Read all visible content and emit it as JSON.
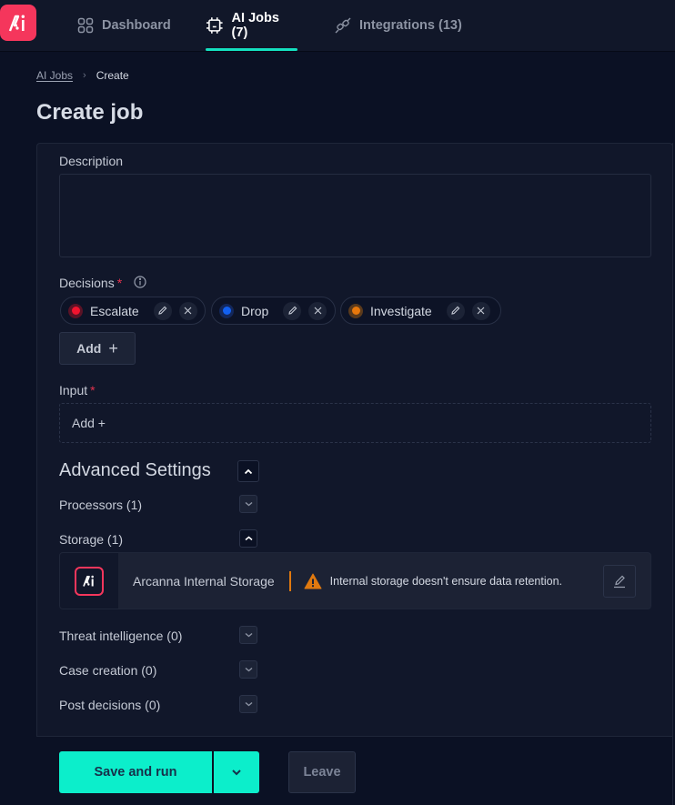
{
  "nav": {
    "logo_text": "Ai",
    "items": [
      {
        "label": "Dashboard",
        "icon": "grid-icon",
        "active": false
      },
      {
        "label": "AI Jobs (7)",
        "icon": "chip-icon",
        "active": true
      },
      {
        "label": "Integrations (13)",
        "icon": "plug-icon",
        "active": false
      }
    ]
  },
  "breadcrumb": {
    "parent": "AI Jobs",
    "separator": "›",
    "current": "Create"
  },
  "page_title": "Create job",
  "form": {
    "description": {
      "label": "Description",
      "value": ""
    },
    "decisions": {
      "label": "Decisions",
      "required_mark": "*",
      "items": [
        {
          "label": "Escalate",
          "color": "#f0142f",
          "halo": "#5a1326"
        },
        {
          "label": "Drop",
          "color": "#1260f0",
          "halo": "#13275a"
        },
        {
          "label": "Investigate",
          "color": "#e8780c",
          "halo": "#5a3a1c"
        }
      ],
      "add_label": "Add",
      "add_icon": "+"
    },
    "input": {
      "label": "Input",
      "required_mark": "*",
      "add_label": "Add +"
    },
    "advanced": {
      "title": "Advanced Settings",
      "expanded": true,
      "sections": [
        {
          "label": "Processors (1)",
          "expanded": false
        },
        {
          "label": "Storage (1)",
          "expanded": true
        },
        {
          "label": "Threat intelligence (0)",
          "expanded": false
        },
        {
          "label": "Case creation (0)",
          "expanded": false
        },
        {
          "label": "Post decisions (0)",
          "expanded": false
        }
      ],
      "storage": {
        "name": "Arcanna Internal Storage",
        "warning": "Internal storage doesn't ensure data retention.",
        "warning_color": "#e0790f"
      }
    }
  },
  "footer": {
    "save_label": "Save and run",
    "leave_label": "Leave"
  },
  "colors": {
    "accent": "#0ceecb",
    "brand": "#f5365c",
    "active_tab_underline": "#14e0c0",
    "required": "#e5334f"
  }
}
